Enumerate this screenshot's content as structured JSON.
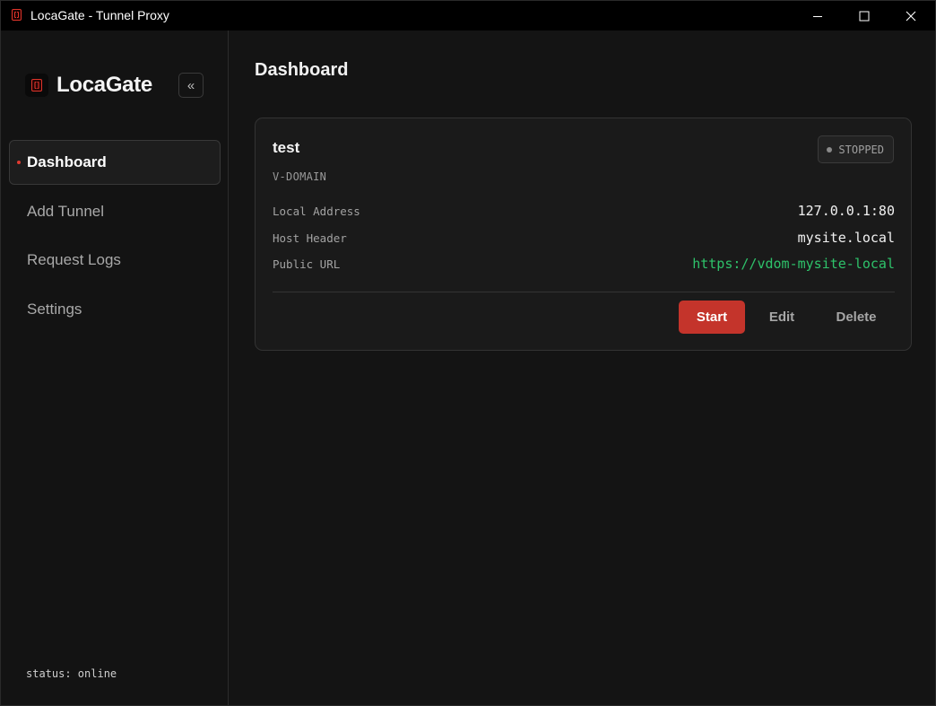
{
  "window": {
    "title": "LocaGate - Tunnel Proxy",
    "icons": {
      "app": "locagate-app-icon",
      "minimize": "minimize-icon",
      "maximize": "maximize-icon",
      "close": "close-icon"
    }
  },
  "sidebar": {
    "brand": "LocaGate",
    "collapse_label": "«",
    "items": [
      {
        "label": "Dashboard",
        "active": true
      },
      {
        "label": "Add Tunnel",
        "active": false
      },
      {
        "label": "Request Logs",
        "active": false
      },
      {
        "label": "Settings",
        "active": false
      }
    ],
    "status": "status: online"
  },
  "main": {
    "title": "Dashboard",
    "tunnels": [
      {
        "name": "test",
        "type": "V-DOMAIN",
        "status": "STOPPED",
        "fields": [
          {
            "label": "Local Address",
            "value": "127.0.0.1:80"
          },
          {
            "label": "Host Header",
            "value": "mysite.local"
          },
          {
            "label": "Public URL",
            "value": "https://vdom-mysite-local"
          }
        ],
        "actions": {
          "start": "Start",
          "edit": "Edit",
          "delete": "Delete"
        }
      }
    ]
  },
  "colors": {
    "accent": "#c4342b",
    "link": "#2ec26a",
    "background": "#141414",
    "card": "#1a1a1a"
  }
}
